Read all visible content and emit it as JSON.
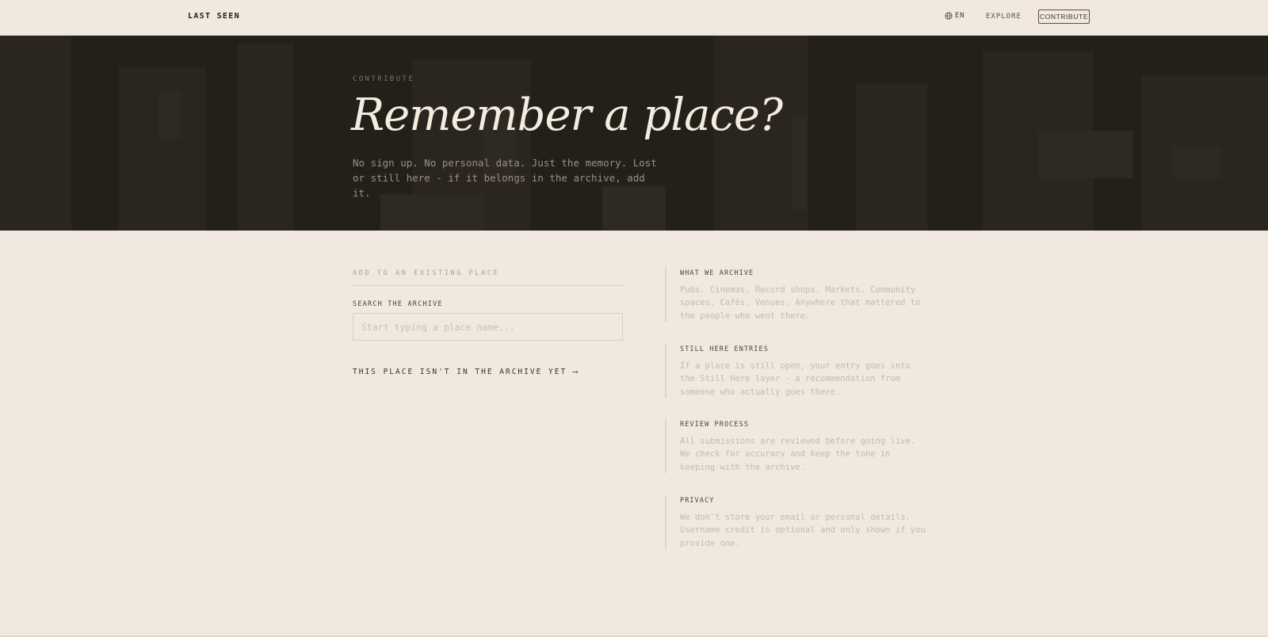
{
  "nav": {
    "brand": "LAST SEEN",
    "lang": "EN",
    "lang_icon": "globe-icon",
    "explore": "EXPLORE",
    "contribute": "CONTRIBUTE"
  },
  "hero": {
    "eyebrow": "CONTRIBUTE",
    "title": "Remember a place?",
    "description": "No sign up. No personal data. Just the memory. Lost or still here - if it belongs in the archive, add it."
  },
  "left": {
    "eyebrow": "ADD TO AN EXISTING PLACE",
    "search_label": "SEARCH THE ARCHIVE",
    "search_placeholder": "Start typing a place name...",
    "not_in_archive": "THIS PLACE ISN'T IN THE ARCHIVE YET ⟶"
  },
  "info": [
    {
      "title": "WHAT WE ARCHIVE",
      "body": "Pubs. Cinemas. Record shops. Markets. Community spaces. Cafés. Venues. Anywhere that mattered to the people who went there."
    },
    {
      "title": "STILL HERE ENTRIES",
      "body": "If a place is still open, your entry goes into the Still Here layer - a recommendation from someone who actually goes there."
    },
    {
      "title": "REVIEW PROCESS",
      "body": "All submissions are reviewed before going live. We check for accuracy and keep the tone in keeping with the archive."
    },
    {
      "title": "PRIVACY",
      "body": "We don't store your email or personal details. Username credit is optional and only shown if you provide one."
    }
  ],
  "colors": {
    "background": "#f1e9df",
    "hero_background": "#232019",
    "hero_title": "#f3ecdf",
    "accent_border": "#6a4a3d"
  }
}
